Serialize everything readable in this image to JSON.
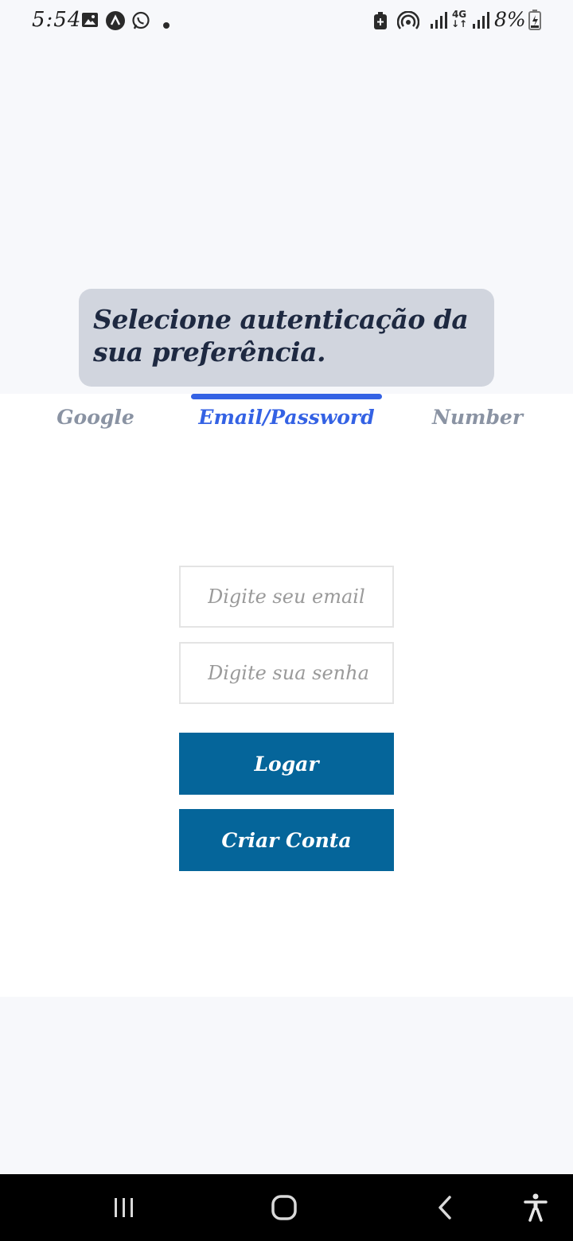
{
  "status_bar": {
    "time": "5:54",
    "battery": "8%",
    "network": "4G",
    "icons": [
      "gallery-icon",
      "app-a-icon",
      "whatsapp-icon",
      "dot-icon",
      "battery-saver-icon",
      "hotspot-icon",
      "signal-icon",
      "signal-4g-icon",
      "signal-icon",
      "battery-charging-icon"
    ]
  },
  "banner": {
    "text": "Selecione autenticação da sua preferência."
  },
  "tabs": [
    {
      "label": "Google",
      "active": false
    },
    {
      "label": "Email/Password",
      "active": true
    },
    {
      "label": "Number",
      "active": false
    }
  ],
  "form": {
    "email_placeholder": "Digite seu email",
    "password_placeholder": "Digite sua senha",
    "login_label": "Logar",
    "create_label": "Criar Conta"
  },
  "colors": {
    "accent": "#3462e4",
    "button": "#05659a",
    "banner_bg": "#d1d5de",
    "banner_text": "#1e2941",
    "inactive_tab": "#8a93a3"
  },
  "nav_bar": {
    "icons": [
      "recent-apps-icon",
      "home-icon",
      "back-icon",
      "accessibility-icon"
    ]
  }
}
